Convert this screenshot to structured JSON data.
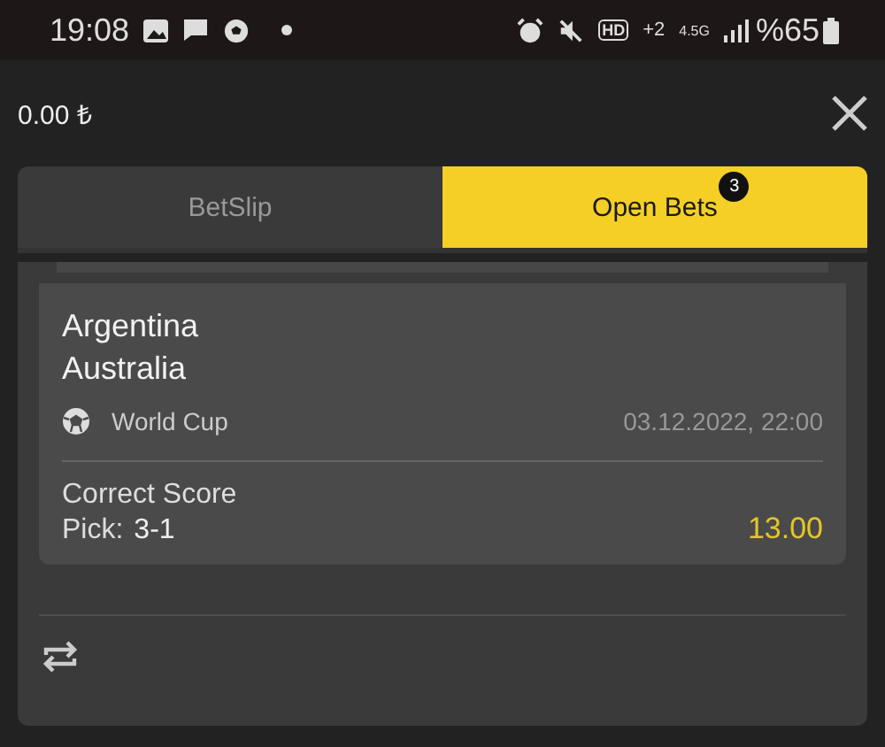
{
  "status_bar": {
    "time": "19:08",
    "hd": "HD",
    "sim": "+2",
    "network": "4.5G",
    "battery": "%65"
  },
  "header": {
    "balance": "0.00 ₺"
  },
  "tabs": [
    {
      "label": "BetSlip",
      "selected": false
    },
    {
      "label": "Open Bets",
      "selected": true,
      "badge": "3"
    }
  ],
  "bet": {
    "home": "Argentina",
    "away": "Australia",
    "competition": "World Cup",
    "datetime": "03.12.2022, 22:00",
    "market": "Correct Score",
    "pick_label": "Pick:",
    "pick": "3-1",
    "odds": "13.00"
  }
}
